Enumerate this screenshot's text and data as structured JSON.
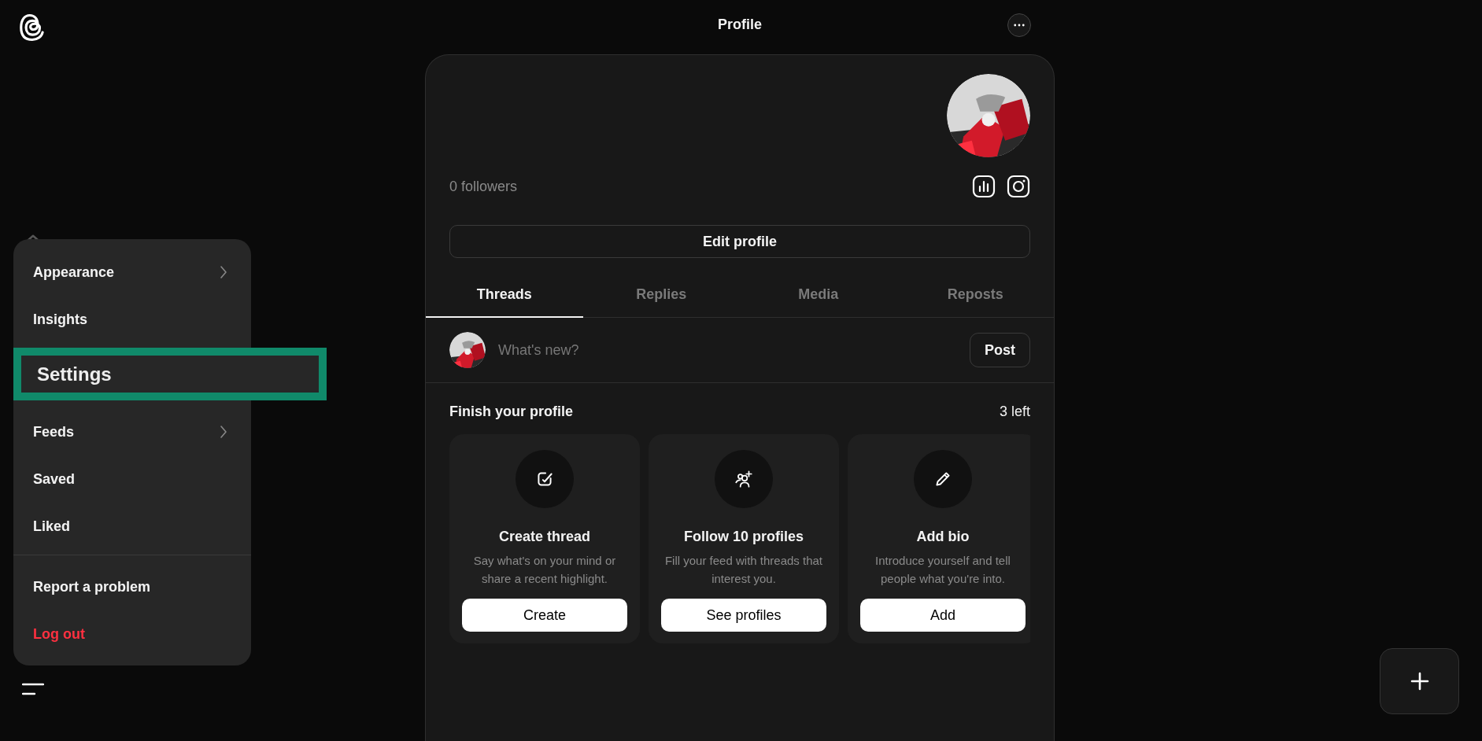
{
  "header": {
    "title": "Profile"
  },
  "menu": {
    "groups": [
      [
        {
          "label": "Appearance",
          "kind": "item",
          "has_submenu": true
        },
        {
          "label": "Insights",
          "kind": "item",
          "has_submenu": false
        },
        {
          "label": "Settings",
          "kind": "highlight",
          "has_submenu": false
        },
        {
          "label": "Feeds",
          "kind": "item",
          "has_submenu": true
        },
        {
          "label": "Saved",
          "kind": "item",
          "has_submenu": false
        },
        {
          "label": "Liked",
          "kind": "item",
          "has_submenu": false
        }
      ],
      [
        {
          "label": "Report a problem",
          "kind": "item",
          "has_submenu": false
        },
        {
          "label": "Log out",
          "kind": "danger",
          "has_submenu": false
        }
      ]
    ]
  },
  "profile": {
    "followers": "0 followers",
    "edit_button": "Edit profile"
  },
  "tabs": [
    {
      "label": "Threads",
      "selected": true
    },
    {
      "label": "Replies",
      "selected": false
    },
    {
      "label": "Media",
      "selected": false
    },
    {
      "label": "Reposts",
      "selected": false
    }
  ],
  "composer": {
    "placeholder": "What's new?",
    "post_button": "Post"
  },
  "finish": {
    "title": "Finish your profile",
    "count": "3 left",
    "cards": [
      {
        "kind": "compose",
        "title": "Create thread",
        "description": "Say what's on your mind or share a recent highlight.",
        "button": "Create"
      },
      {
        "kind": "follow",
        "title": "Follow 10 profiles",
        "description": "Fill your feed with threads that interest you.",
        "button": "See profiles"
      },
      {
        "kind": "pencil",
        "title": "Add bio",
        "description": "Introduce yourself and tell people what you're into.",
        "button": "Add"
      }
    ]
  }
}
